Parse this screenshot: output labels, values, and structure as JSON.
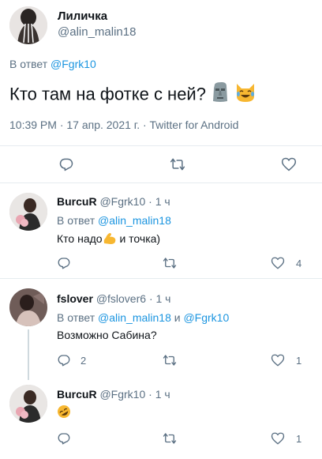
{
  "main_tweet": {
    "author_name": "Лиличка",
    "author_handle": "@alin_malin18",
    "reply_prefix": "В ответ",
    "reply_to": "@Fgrk10",
    "text": "Кто там на фотке с ней?",
    "emojis": [
      "moai-emoji",
      "cat-tears-of-joy-emoji"
    ],
    "timestamp": "10:39 PM · 17 апр. 2021 г. · Twitter for Android"
  },
  "replies": [
    {
      "author_name": "BurcuR",
      "author_handle": "@Fgrk10",
      "time": "· 1 ч",
      "reply_prefix": "В ответ",
      "reply_to": "@alin_malin18",
      "text_before": "Кто надо",
      "emoji": "flexed-biceps-emoji",
      "text_after": " и точка)",
      "reply_count": "",
      "like_count": "4"
    },
    {
      "author_name": "fslover",
      "author_handle": "@fslover6",
      "time": "· 1 ч",
      "reply_prefix": "В ответ",
      "reply_to": "@alin_malin18",
      "reply_and": " и ",
      "reply_to_2": "@Fgrk10",
      "text": "Возможно Сабина?",
      "reply_count": "2",
      "like_count": "1"
    },
    {
      "author_name": "BurcuR",
      "author_handle": "@Fgrk10",
      "time": "· 1 ч",
      "emoji": "rolling-on-floor-laughing-emoji",
      "reply_count": "",
      "like_count": "1"
    }
  ],
  "colors": {
    "link": "#1b95e0",
    "muted": "#5b7083",
    "divider": "#e6ecf0"
  }
}
